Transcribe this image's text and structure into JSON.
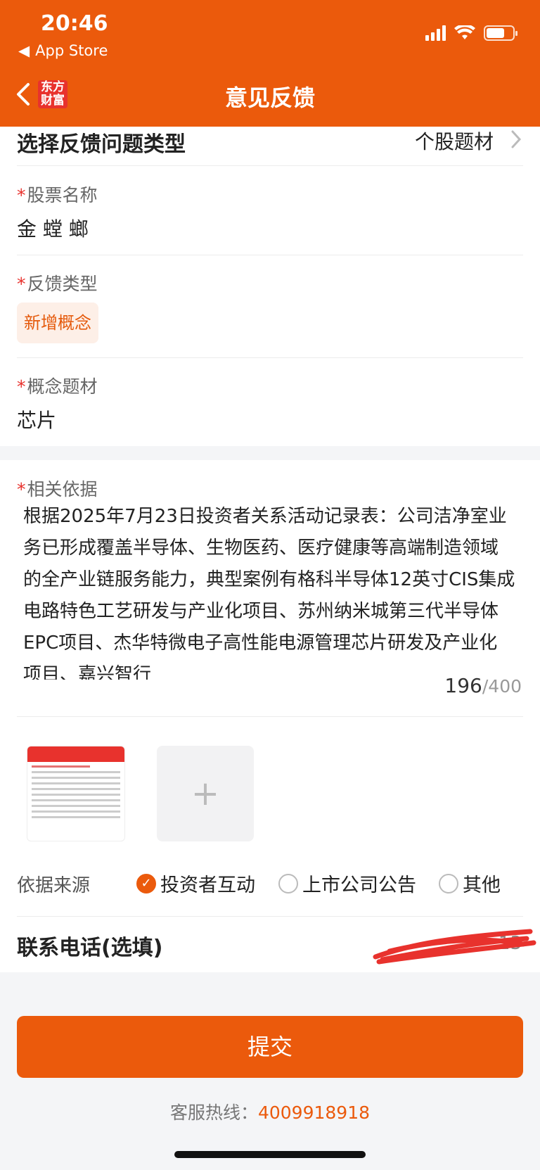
{
  "status": {
    "time": "20:46",
    "back_app": "App Store"
  },
  "nav": {
    "logo_text_1": "东方",
    "logo_text_2": "财富",
    "title": "意见反馈"
  },
  "form": {
    "type_label": "选择反馈问题类型",
    "type_value": "个股题材",
    "stock_label": "股票名称",
    "stock_value": "金 螳 螂",
    "feedback_type_label": "反馈类型",
    "feedback_type_tag": "新增概念",
    "concept_label": "概念题材",
    "concept_value": "芯片",
    "basis_label": "相关依据",
    "basis_text": "根据2025年7月23日投资者关系活动记录表：公司洁净室业务已形成覆盖半导体、生物医药、医疗健康等高端制造领域的全产业链服务能力，典型案例有格科半导体12英寸CIS集成电路特色工艺研发与产业化项目、苏州纳米城第三代半导体EPC项目、杰华特微电子高性能电源管理芯片研发及产业化项目、嘉兴智行",
    "counter_current": "196",
    "counter_max": "/400",
    "source_label": "依据来源",
    "source_options": [
      "投资者互动",
      "上市公司公告",
      "其他"
    ],
    "source_selected": "投资者互动",
    "phone_label": "联系电话(选填)",
    "phone_value": "13",
    "submit_label": "提交"
  },
  "footer": {
    "hotline_label": "客服热线：",
    "hotline_number": "4009918918"
  },
  "colors": {
    "brand": "#eb5a0c",
    "required": "#e8322d"
  }
}
